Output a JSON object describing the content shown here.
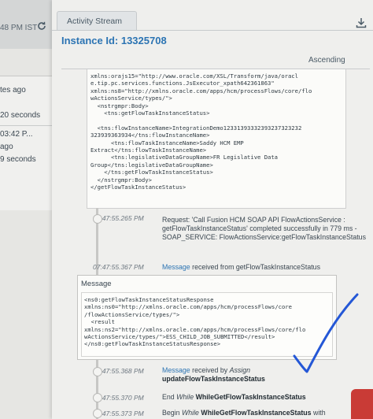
{
  "left": {
    "time_text": "48 PM IST",
    "rows": [
      "tes ago",
      "20 seconds",
      "03:42 P...",
      "ago",
      "9 seconds"
    ]
  },
  "main": {
    "tab_label": "Activity Stream",
    "title": "Instance Id: 13325708",
    "sort_label": "Ascending"
  },
  "xml_request": {
    "lines": [
      "xmlns:orajs15=\"http://www.oracle.com/XSL/Transform/java/oracl",
      "e.tip.pc.services.functions.JsExecutor_xpath642361863\"",
      "xmlns:ns8=\"http://xmlns.oracle.com/apps/hcm/processFlows/core/flo",
      "wActionsService/types/\">",
      "  <nstrgmpr:Body>",
      "    <tns:getFlowTaskInstanceStatus>",
      "",
      "  <tns:flowInstanceName>IntegrationDemo12331393332393237323232",
      "323939363934</tns:flowInstanceName>",
      "      <tns:flowTaskInstanceName>Saddy HCM EMP",
      "Extract</tns:flowTaskInstanceName>",
      "      <tns:legislativeDataGroupName>FR Legislative Data",
      "Group</tns:legislativeDataGroupName>",
      "    </tns:getFlowTaskInstanceStatus>",
      "  </nstrgmpr:Body>",
      "</getFlowTaskInstanceStatus>"
    ]
  },
  "timeline": [
    {
      "time": "07:47:55.265 PM",
      "text_html_parts": {
        "plain": "Request: 'Call Fusion HCM SOAP API FlowActionsService : getFlowTaskInstanceStatus' completed successfully in 779 ms - SOAP_SERVICE: FlowActionsService:getFlowTaskInstanceStatus"
      }
    },
    {
      "time": "07:47:55.367 PM",
      "link": "Message",
      "rest": " received from getFlowTaskInstanceStatus"
    },
    {
      "time": "07:47:55.368 PM",
      "link": "Message",
      "rest": " received by ",
      "italic": "Assign",
      "bold": "updateFlowTaskInstanceStatus"
    },
    {
      "time": "07:47:55.370 PM",
      "prefix": "End ",
      "italic": "While",
      "bold": "WhileGetFlowTaskInstanceStatus"
    },
    {
      "time": "07:47:55.373 PM",
      "prefix": "Begin ",
      "italic": "While",
      "bold": "WhileGetFlowTaskInstanceStatus",
      "rest": " with"
    }
  ],
  "message_box": {
    "title": "Message",
    "lines": [
      "<ns0:getFlowTaskInstanceStatusResponse",
      "xmlns:ns0=\"http://xmlns.oracle.com/apps/hcm/processFlows/core",
      "/flowActionsService/types/\">",
      "  <result",
      "xmlns:ns2=\"http://xmlns.oracle.com/apps/hcm/processFlows/core/flo",
      "wActionsService/types/\">ESS_CHILD_JOB_SUBMITTED</result>",
      "</ns0:getFlowTaskInstanceStatusResponse>"
    ]
  },
  "colors": {
    "accent": "#2c74b3",
    "checkmark": "#2457d6"
  }
}
